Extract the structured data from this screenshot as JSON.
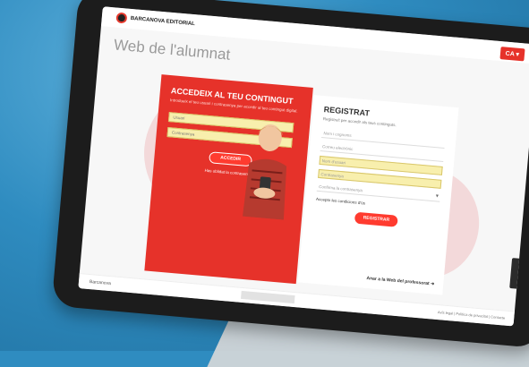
{
  "header": {
    "logo_text": "BARCANOVA EDITORIAL",
    "language": "CA ▾"
  },
  "page": {
    "title": "Web de l'alumnat"
  },
  "login": {
    "title": "ACCEDEIX AL TEU CONTINGUT",
    "description": "Introdueix el teu usuari i contrasenya per accedir al teu contingut digital.",
    "username_placeholder": "Usuari",
    "password_placeholder": "Contrasenya",
    "submit": "ACCEDIR",
    "forgot": "Has oblidat la contrasenya?"
  },
  "register": {
    "title": "REGISTRAT",
    "description": "Registra't per accedir als teus continguts.",
    "fields": [
      "Nom i cognoms",
      "Correu electrònic",
      "Nom d'usuari",
      "Contrasenya",
      "Confirma la contrasenya"
    ],
    "terms": "Accepto les condicions d'ús",
    "submit": "REGISTRAR",
    "pro_link": "Anar a la Web del professorat ➜"
  },
  "footer": {
    "left": "Barcanova",
    "right": "Avís legal | Política de privacitat | Contacte"
  }
}
